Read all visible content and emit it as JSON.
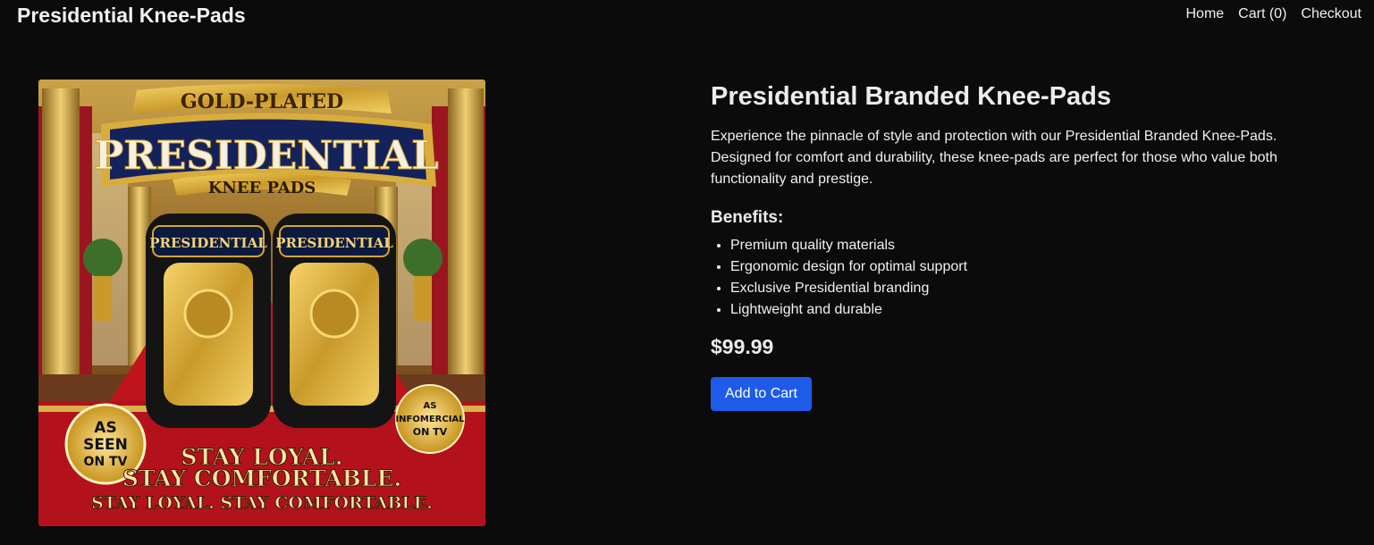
{
  "header": {
    "brand": "Presidential Knee-Pads",
    "nav": [
      {
        "label": "Home"
      },
      {
        "label": "Cart (0)"
      },
      {
        "label": "Checkout"
      }
    ]
  },
  "product": {
    "title": "Presidential Branded Knee-Pads",
    "description": "Experience the pinnacle of style and protection with our Presidential Branded Knee-Pads. Designed for comfort and durability, these knee-pads are perfect for those who value both functionality and prestige.",
    "benefits_heading": "Benefits:",
    "benefits": [
      "Premium quality materials",
      "Ergonomic design for optimal support",
      "Exclusive Presidential branding",
      "Lightweight and durable"
    ],
    "price": "$99.99",
    "add_to_cart": "Add to Cart"
  },
  "image": {
    "banner_top": "GOLD-PLATED",
    "banner_main": "PRESIDENTIAL",
    "banner_sub": "KNEE PADS",
    "pad_label": "PRESIDENTIAL",
    "seal_left": [
      "AS",
      "SEEN",
      "ON TV"
    ],
    "seal_right": [
      "AS",
      "INFOMERCIAL",
      "ON TV"
    ],
    "slogan_1": "STAY LOYAL.",
    "slogan_2": "STAY COMFORTABLE.",
    "slogan_3": "STAY LOYAL. STAY COMFORTABLE."
  },
  "colors": {
    "background": "#0b0b0b",
    "button": "#1f5be9",
    "gold": "#d4a72c",
    "carpet_red": "#b3121c"
  }
}
